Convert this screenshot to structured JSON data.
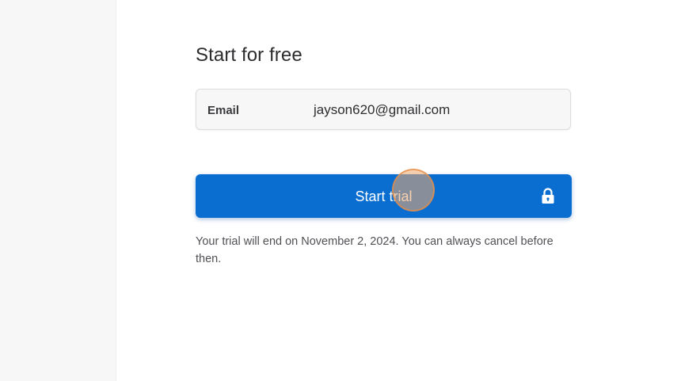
{
  "form": {
    "heading": "Start for free",
    "email": {
      "label": "Email",
      "value": "jayson620@gmail.com"
    },
    "start_button": {
      "label": "Start trial",
      "icon": "lock-icon"
    },
    "note": "Your trial will end on November 2, 2024. You can always cancel before then."
  },
  "colors": {
    "button_bg": "#0a6ed1",
    "button_text": "#ffffff",
    "field_bg": "#f7f7f7",
    "left_panel_bg": "#f7f7f8"
  }
}
